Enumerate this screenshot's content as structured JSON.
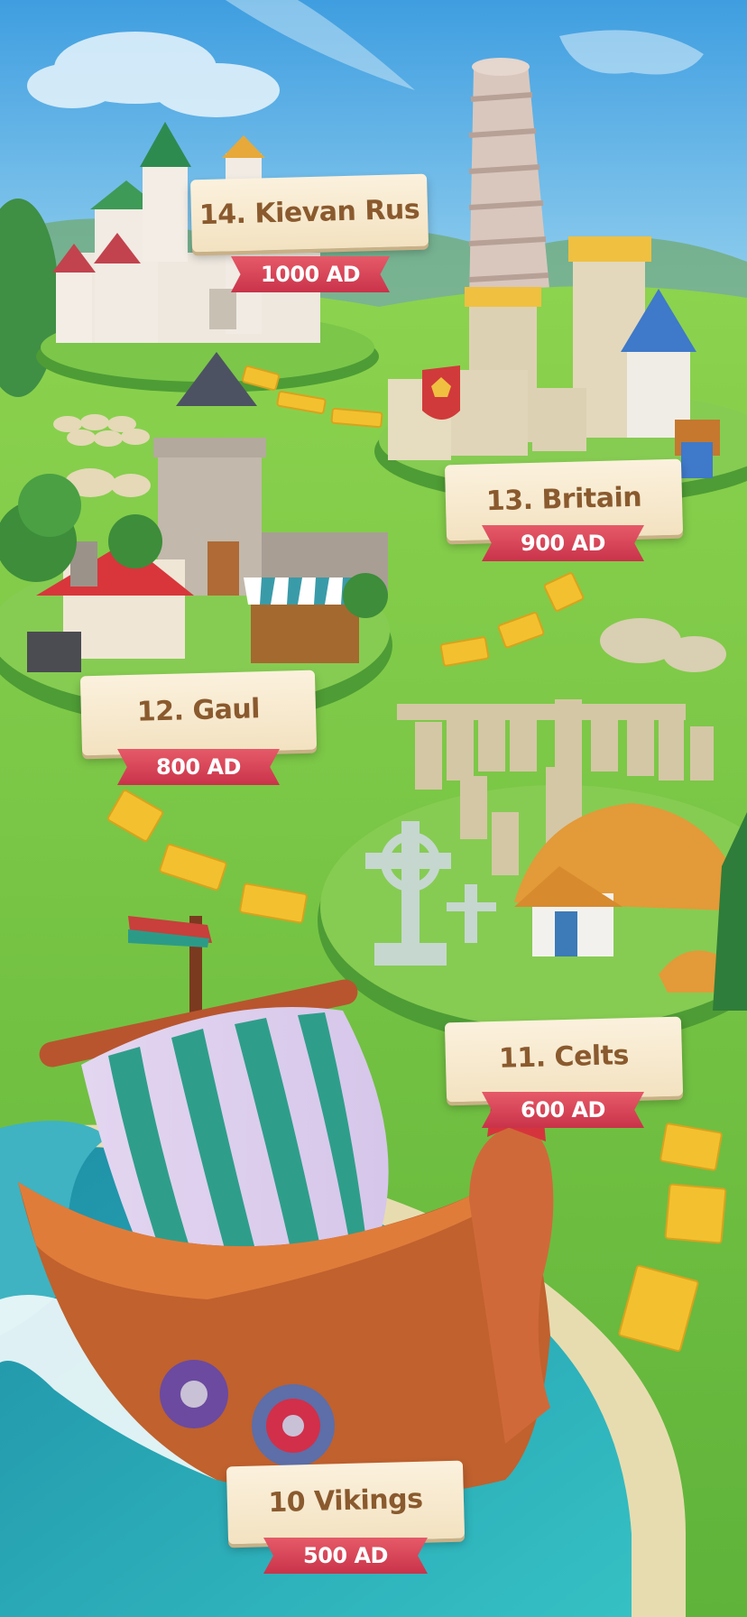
{
  "levels": [
    {
      "name": "14. Kievan Rus",
      "era": "1000 AD"
    },
    {
      "name": "13. Britain",
      "era": "900 AD"
    },
    {
      "name": "12. Gaul",
      "era": "800 AD"
    },
    {
      "name": "11. Celts",
      "era": "600 AD"
    },
    {
      "name": "10 Vikings",
      "era": "500 AD"
    }
  ],
  "colors": {
    "sky": "#5fb4e8",
    "grass": "#6cbf3d",
    "path_tile": "#f5c431",
    "ribbon": "#d63d55",
    "plaque": "#f7e9cf",
    "plaque_text": "#8a5a2e",
    "water": "#2ea8b8"
  }
}
